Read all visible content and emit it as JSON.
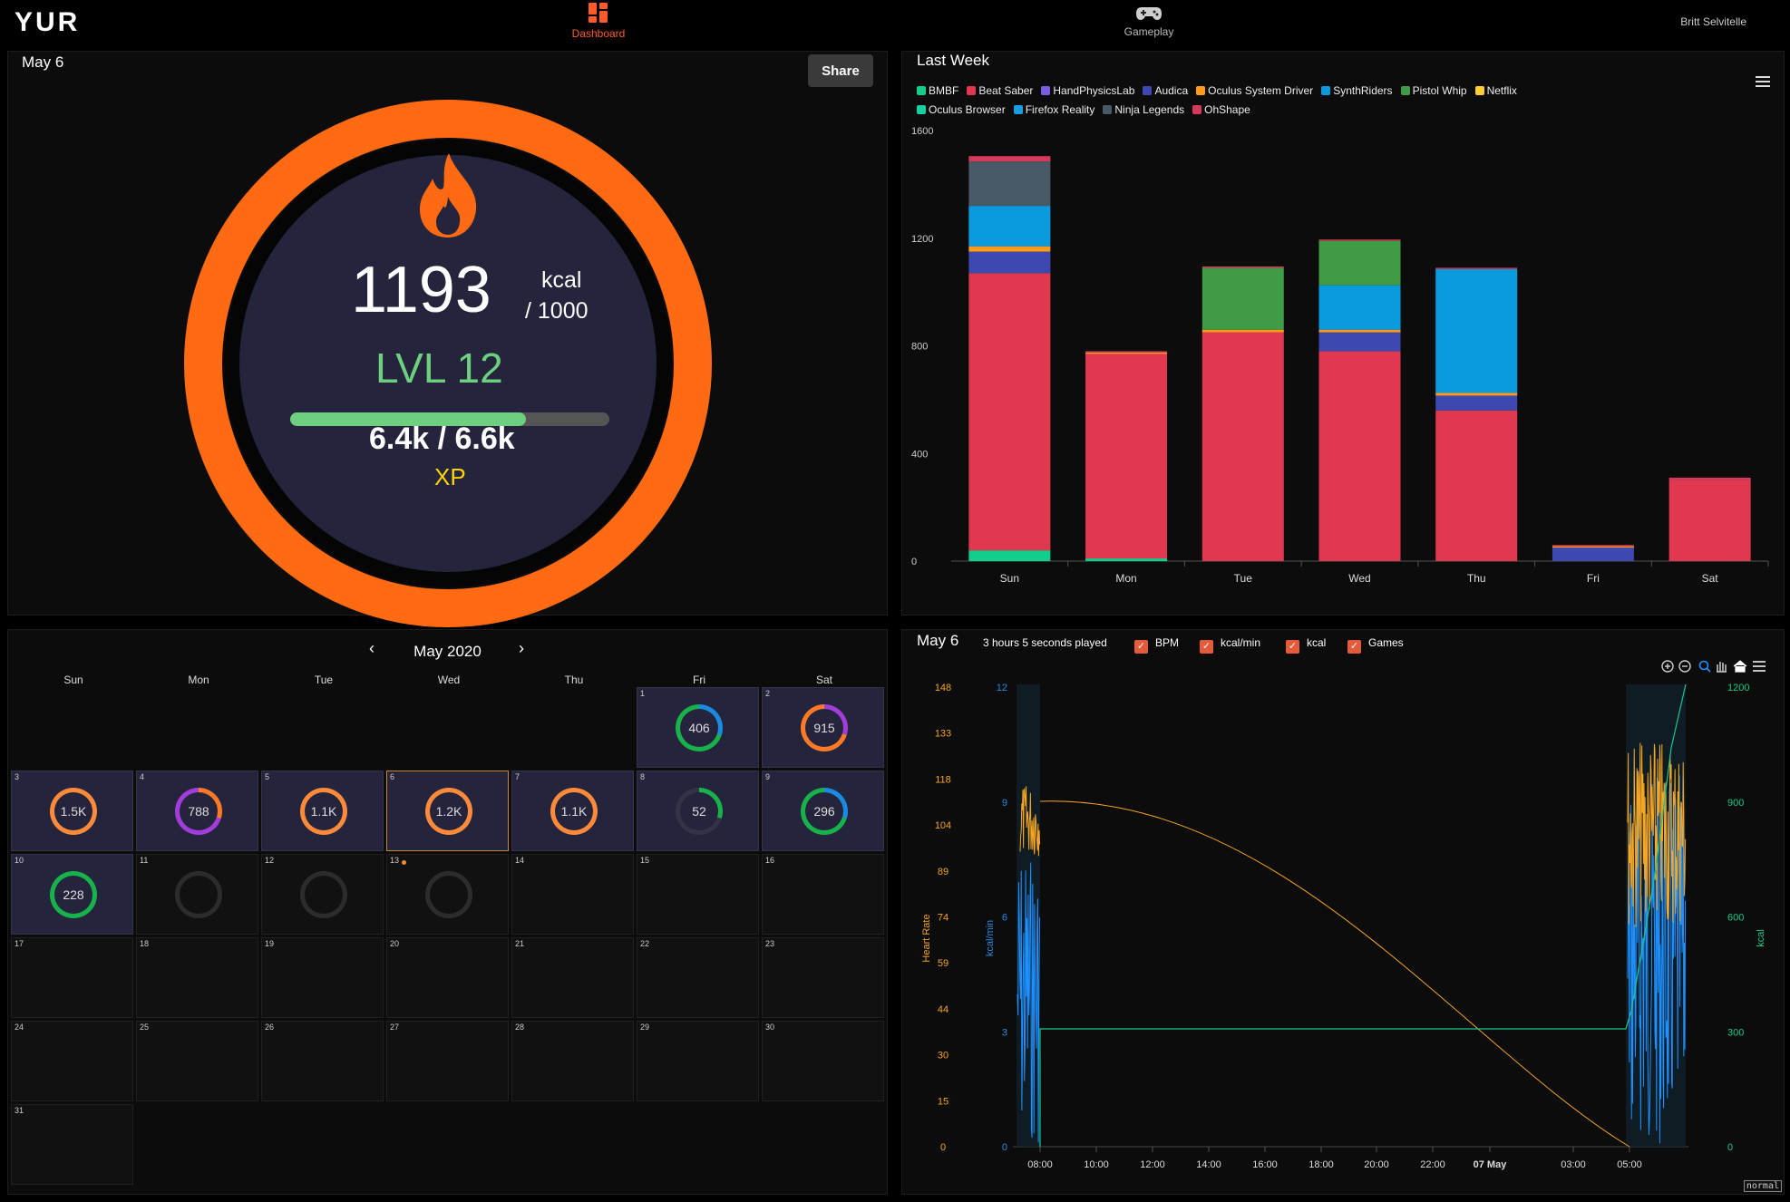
{
  "app": {
    "logo": "YUR",
    "user": "Britt Selvitelle"
  },
  "nav": [
    {
      "label": "Dashboard",
      "active": true
    },
    {
      "label": "Gameplay",
      "active": false
    }
  ],
  "daily": {
    "date": "May 6",
    "share_label": "Share",
    "kcal": "1193",
    "kcal_unit": "kcal",
    "kcal_goal": "/ 1000",
    "level": "LVL 12",
    "xp_text": "6.4k / 6.6k",
    "xp_label": "XP",
    "xp_progress": 0.74,
    "colors": {
      "ring": "#ff6a13",
      "level": "#6dcf7f",
      "xp": "#ffd400",
      "face": "#24243c"
    }
  },
  "calendar": {
    "month": "May 2020",
    "prev": "‹",
    "next": "›",
    "weekdays": [
      "Sun",
      "Mon",
      "Tue",
      "Wed",
      "Thu",
      "Fri",
      "Sat"
    ],
    "days": [
      {
        "d": "1",
        "value": "406",
        "col": 5,
        "row": 0
      },
      {
        "d": "2",
        "value": "915",
        "col": 6,
        "row": 0
      },
      {
        "d": "3",
        "value": "1.5K",
        "col": 0,
        "row": 1
      },
      {
        "d": "4",
        "value": "788",
        "col": 1,
        "row": 1
      },
      {
        "d": "5",
        "value": "1.1K",
        "col": 2,
        "row": 1
      },
      {
        "d": "6",
        "value": "1.2K",
        "col": 3,
        "row": 1
      },
      {
        "d": "7",
        "value": "1.1K",
        "col": 4,
        "row": 1
      },
      {
        "d": "8",
        "value": "52",
        "col": 5,
        "row": 1
      },
      {
        "d": "9",
        "value": "296",
        "col": 6,
        "row": 1
      },
      {
        "d": "10",
        "value": "228",
        "col": 0,
        "row": 2
      },
      {
        "d": "11",
        "value": "",
        "col": 1,
        "row": 2
      },
      {
        "d": "12",
        "value": "",
        "col": 2,
        "row": 2
      },
      {
        "d": "13",
        "value": "",
        "col": 3,
        "row": 2
      },
      {
        "d": "14",
        "value": "",
        "col": 4,
        "row": 2
      },
      {
        "d": "15",
        "value": "",
        "col": 5,
        "row": 2
      },
      {
        "d": "16",
        "value": "",
        "col": 6,
        "row": 2
      },
      {
        "d": "17",
        "value": "",
        "col": 0,
        "row": 3
      },
      {
        "d": "18",
        "value": "",
        "col": 1,
        "row": 3
      },
      {
        "d": "19",
        "value": "",
        "col": 2,
        "row": 3
      },
      {
        "d": "20",
        "value": "",
        "col": 3,
        "row": 3
      },
      {
        "d": "21",
        "value": "",
        "col": 4,
        "row": 3
      },
      {
        "d": "22",
        "value": "",
        "col": 5,
        "row": 3
      },
      {
        "d": "23",
        "value": "",
        "col": 6,
        "row": 3
      },
      {
        "d": "24",
        "value": "",
        "col": 0,
        "row": 4
      },
      {
        "d": "25",
        "value": "",
        "col": 1,
        "row": 4
      },
      {
        "d": "26",
        "value": "",
        "col": 2,
        "row": 4
      },
      {
        "d": "27",
        "value": "",
        "col": 3,
        "row": 4
      },
      {
        "d": "28",
        "value": "",
        "col": 4,
        "row": 4
      },
      {
        "d": "29",
        "value": "",
        "col": 5,
        "row": 4
      },
      {
        "d": "30",
        "value": "",
        "col": 6,
        "row": 4
      },
      {
        "d": "31",
        "value": "",
        "col": 0,
        "row": 5
      }
    ]
  },
  "chart_data": [
    {
      "type": "bar",
      "stacked": true,
      "title": "Last Week",
      "categories": [
        "Sun",
        "Mon",
        "Tue",
        "Wed",
        "Thu",
        "Fri",
        "Sat"
      ],
      "ylim": [
        0,
        1600
      ],
      "yticks": [
        0,
        400,
        800,
        1200,
        1600
      ],
      "legend_position": "top-left",
      "series": [
        {
          "name": "BMBF",
          "color": "#0fcf8a",
          "values": [
            40,
            10,
            0,
            0,
            0,
            0,
            0
          ]
        },
        {
          "name": "Beat Saber",
          "color": "#e0384f",
          "values": [
            1030,
            760,
            850,
            780,
            560,
            0,
            300
          ]
        },
        {
          "name": "HandPhysicsLab",
          "color": "#7b5ee0",
          "values": [
            0,
            0,
            0,
            0,
            0,
            0,
            0
          ]
        },
        {
          "name": "Audica",
          "color": "#3d49b0",
          "values": [
            80,
            0,
            0,
            70,
            55,
            50,
            0
          ]
        },
        {
          "name": "Oculus System Driver",
          "color": "#ff9a1a",
          "values": [
            20,
            5,
            10,
            10,
            10,
            5,
            0
          ]
        },
        {
          "name": "SynthRiders",
          "color": "#0a9bdf",
          "values": [
            150,
            0,
            0,
            165,
            460,
            0,
            0
          ]
        },
        {
          "name": "Pistol Whip",
          "color": "#3f9b45",
          "values": [
            0,
            0,
            230,
            165,
            0,
            0,
            0
          ]
        },
        {
          "name": "Netflix",
          "color": "#ffcc33",
          "values": [
            0,
            0,
            0,
            0,
            0,
            0,
            0
          ]
        },
        {
          "name": "Oculus Browser",
          "color": "#12d1a0",
          "values": [
            0,
            0,
            0,
            0,
            0,
            0,
            0
          ]
        },
        {
          "name": "Firefox Reality",
          "color": "#1a9ee0",
          "values": [
            0,
            0,
            0,
            0,
            0,
            0,
            0
          ]
        },
        {
          "name": "Ninja Legends",
          "color": "#4a5966",
          "values": [
            165,
            0,
            0,
            0,
            0,
            0,
            0
          ]
        },
        {
          "name": "OhShape",
          "color": "#d63a5a",
          "values": [
            20,
            5,
            5,
            5,
            5,
            5,
            10
          ]
        }
      ]
    },
    {
      "type": "line",
      "title": "May 6",
      "subtitle": "3 hours 5 seconds played",
      "toggles": [
        "BPM",
        "kcal/min",
        "kcal",
        "Games"
      ],
      "x_ticks": [
        "08:00",
        "10:00",
        "12:00",
        "14:00",
        "16:00",
        "18:00",
        "20:00",
        "22:00",
        "07 May",
        "03:00",
        "05:00"
      ],
      "y_left": {
        "label": "Heart Rate",
        "ticks": [
          "0",
          "15",
          "30",
          "44",
          "59",
          "74",
          "89",
          "104",
          "118",
          "133",
          "148"
        ],
        "color": "#f5a623"
      },
      "y_mid": {
        "label": "kcal/min",
        "ticks": [
          "0",
          "3",
          "6",
          "9",
          "12"
        ],
        "color": "#2a8be0"
      },
      "y_right": {
        "label": "kcal",
        "ticks": [
          "0",
          "300",
          "600",
          "900",
          "1200"
        ],
        "color": "#17c98f"
      },
      "series": [
        {
          "name": "BPM",
          "color": "#f5a623"
        },
        {
          "name": "kcal/min",
          "color": "#1e90ff"
        },
        {
          "name": "kcal",
          "color": "#17c98f"
        }
      ],
      "tools": [
        "zoom-in-icon",
        "zoom-out-icon",
        "magnifier-icon",
        "pan-hand-icon",
        "home-icon",
        "menu-icon"
      ],
      "badge": "normal"
    }
  ]
}
